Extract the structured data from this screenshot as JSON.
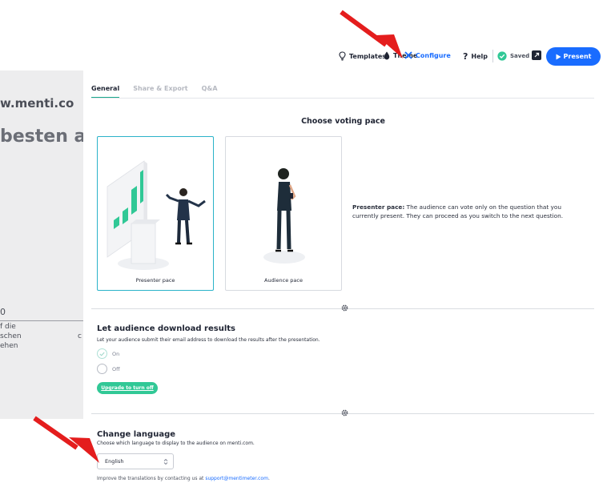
{
  "toolbar": {
    "templates": "Templates",
    "theme": "Theme",
    "configure": "Configure",
    "help": "Help",
    "saved": "Saved",
    "present": "Present"
  },
  "background": {
    "url_fragment": "w.menti.co",
    "heading_fragment": "besten ar",
    "count": "0",
    "line1": "f die",
    "line2": "schen",
    "line3": "ehen",
    "letter": "c"
  },
  "tabs": [
    "General",
    "Share & Export",
    "Q&A"
  ],
  "voting_pace": {
    "title": "Choose voting pace",
    "cards": [
      {
        "label": "Presenter pace",
        "selected": true
      },
      {
        "label": "Audience pace",
        "selected": false
      }
    ],
    "desc_bold": "Presenter pace:",
    "desc_rest": " The audience can vote only on the question that you currently present. They can proceed as you switch to the next question."
  },
  "download": {
    "title": "Let audience download results",
    "desc": "Let your audience submit their email address to download the results after the presentation.",
    "on_label": "On",
    "off_label": "Off",
    "selected": "On",
    "upgrade": "Upgrade to turn off"
  },
  "language": {
    "title": "Change language",
    "desc": "Choose which language to display to the audience on menti.com.",
    "selected": "English",
    "improve_prefix": "Improve the translations by contacting us at ",
    "email": "support@mentimeter.com",
    "improve_suffix": "."
  },
  "colors": {
    "accent_blue": "#196cff",
    "accent_green": "#31c896",
    "selected_border": "#2bb3c9",
    "tab_underline": "#1aa88c",
    "annotation_red": "#e41d1d"
  },
  "icons": [
    "lightbulb-icon",
    "drop-icon",
    "cross-icon",
    "question-icon",
    "check-circle-icon",
    "popout-icon",
    "play-icon",
    "gear-icon",
    "chevron-updown-icon"
  ]
}
